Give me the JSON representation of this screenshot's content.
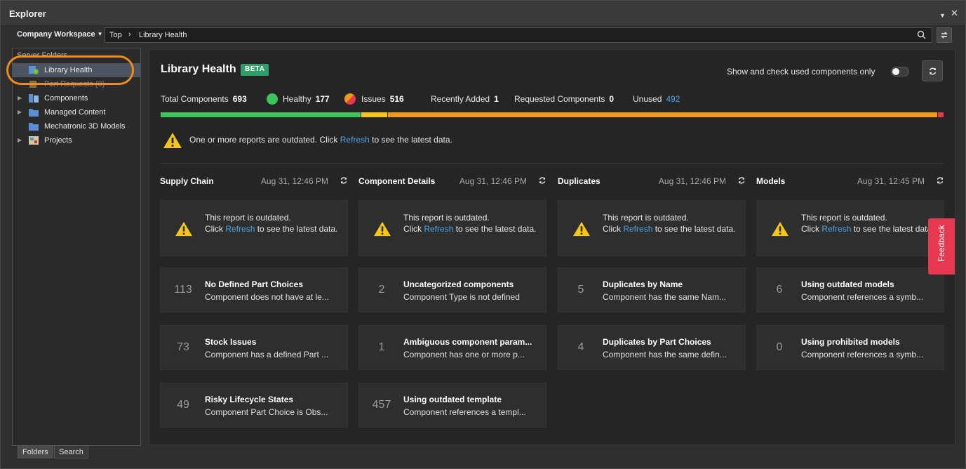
{
  "window": {
    "title": "Explorer"
  },
  "address": {
    "workspace": "Company Workspace",
    "crumbs": [
      "Top",
      "Library Health"
    ]
  },
  "tree": {
    "header": "Server Folders",
    "items": [
      {
        "label": "Library Health",
        "icon": "library-health-icon",
        "selected": true
      },
      {
        "label": "Part Requests (0)",
        "icon": "part-requests-icon"
      },
      {
        "label": "Components",
        "icon": "components-icon"
      },
      {
        "label": "Managed Content",
        "icon": "folder-icon"
      },
      {
        "label": "Mechatronic 3D Models",
        "icon": "folder-icon"
      },
      {
        "label": "Projects",
        "icon": "projects-icon"
      }
    ]
  },
  "bottom_tabs": [
    "Folders",
    "Search"
  ],
  "main": {
    "title": "Library Health",
    "badge": "BETA",
    "toggle_label": "Show and check used components only",
    "stats": {
      "total_label": "Total Components",
      "total_value": "693",
      "healthy_label": "Healthy",
      "healthy_value": "177",
      "issues_label": "Issues",
      "issues_value": "516",
      "recent_label": "Recently Added",
      "recent_value": "1",
      "requested_label": "Requested Components",
      "requested_value": "0",
      "unused_label": "Unused",
      "unused_value": "492"
    },
    "banner": {
      "pre": "One or more reports are outdated. Click ",
      "link": "Refresh",
      "post": " to see the latest data."
    },
    "outdated_card": {
      "line1": "This report is outdated.",
      "pre": "Click ",
      "link": "Refresh",
      "post": " to see the latest data."
    },
    "columns": [
      {
        "name": "Supply Chain",
        "time": "Aug 31, 12:46 PM",
        "cards": [
          {
            "num": "113",
            "title": "No Defined Part Choices",
            "desc": "Component does not have at le..."
          },
          {
            "num": "73",
            "title": "Stock Issues",
            "desc": "Component has a defined Part ..."
          },
          {
            "num": "49",
            "title": "Risky Lifecycle States",
            "desc": "Component Part Choice is Obs..."
          }
        ]
      },
      {
        "name": "Component Details",
        "time": "Aug 31, 12:46 PM",
        "cards": [
          {
            "num": "2",
            "title": "Uncategorized components",
            "desc": "Component Type is not defined"
          },
          {
            "num": "1",
            "title": "Ambiguous component param...",
            "desc": "Component has one or more p..."
          },
          {
            "num": "457",
            "title": "Using outdated template",
            "desc": "Component references a templ..."
          }
        ]
      },
      {
        "name": "Duplicates",
        "time": "Aug 31, 12:46 PM",
        "cards": [
          {
            "num": "5",
            "title": "Duplicates by Name",
            "desc": "Component has the same Nam..."
          },
          {
            "num": "4",
            "title": "Duplicates by Part Choices",
            "desc": "Component has the same defin..."
          }
        ]
      },
      {
        "name": "Models",
        "time": "Aug 31, 12:45 PM",
        "cards": [
          {
            "num": "6",
            "title": "Using outdated models",
            "desc": "Component references a symb..."
          },
          {
            "num": "0",
            "title": "Using prohibited models",
            "desc": "Component references a symb..."
          }
        ]
      }
    ]
  },
  "feedback_label": "Feedback",
  "colors": {
    "healthy": "#3ec45a",
    "issues": "#f09a1a",
    "recent": "#f5c518",
    "unused": "#e8384f",
    "link": "#4da3e6",
    "badge": "#2f9e6b"
  }
}
